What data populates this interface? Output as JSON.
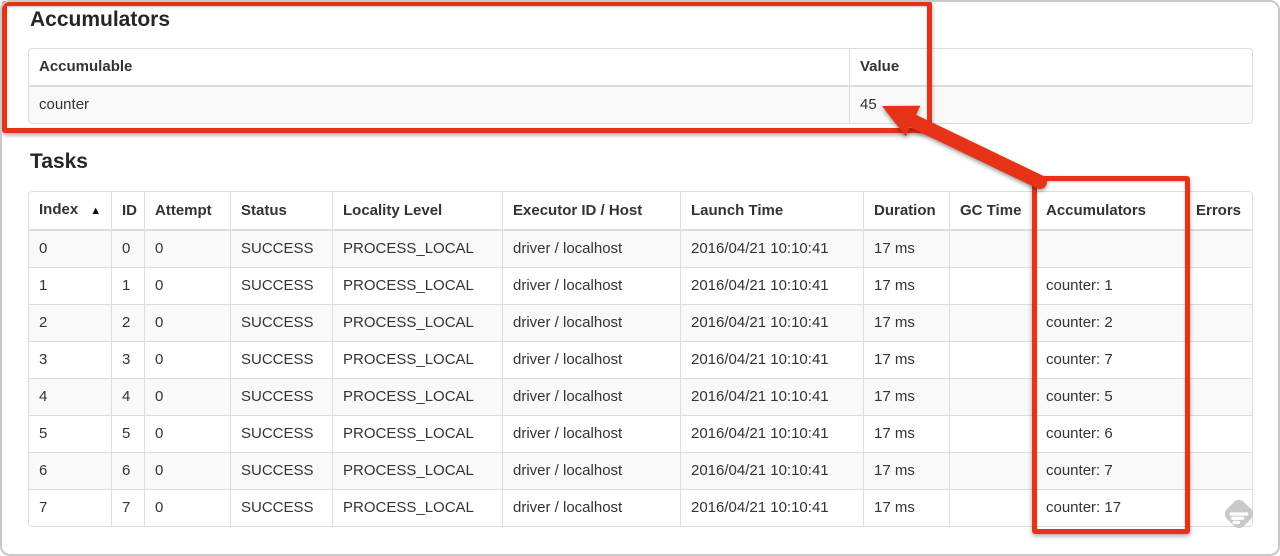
{
  "annotation": {
    "color": "#e63317",
    "highlighted_value": "45",
    "highlighted_column": "Accumulators"
  },
  "accumulators_section": {
    "title": "Accumulators",
    "table": {
      "headers": [
        "Accumulable",
        "Value"
      ],
      "column_keys": [
        "accumulable",
        "value"
      ],
      "rows": [
        [
          "counter",
          "45"
        ]
      ]
    }
  },
  "tasks_section": {
    "title": "Tasks",
    "table": {
      "headers": [
        "Index",
        "ID",
        "Attempt",
        "Status",
        "Locality Level",
        "Executor ID / Host",
        "Launch Time",
        "Duration",
        "GC Time",
        "Accumulators",
        "Errors"
      ],
      "column_keys": [
        "index",
        "id",
        "attempt",
        "status",
        "locality-level",
        "executor-id-host",
        "launch-time",
        "duration",
        "gc-time",
        "accumulators",
        "errors"
      ],
      "sort_icon": "▲",
      "sorted_column": "Index",
      "rows": [
        [
          "0",
          "0",
          "0",
          "SUCCESS",
          "PROCESS_LOCAL",
          "driver / localhost",
          "2016/04/21 10:10:41",
          "17 ms",
          "",
          "",
          ""
        ],
        [
          "1",
          "1",
          "0",
          "SUCCESS",
          "PROCESS_LOCAL",
          "driver / localhost",
          "2016/04/21 10:10:41",
          "17 ms",
          "",
          "counter: 1",
          ""
        ],
        [
          "2",
          "2",
          "0",
          "SUCCESS",
          "PROCESS_LOCAL",
          "driver / localhost",
          "2016/04/21 10:10:41",
          "17 ms",
          "",
          "counter: 2",
          ""
        ],
        [
          "3",
          "3",
          "0",
          "SUCCESS",
          "PROCESS_LOCAL",
          "driver / localhost",
          "2016/04/21 10:10:41",
          "17 ms",
          "",
          "counter: 7",
          ""
        ],
        [
          "4",
          "4",
          "0",
          "SUCCESS",
          "PROCESS_LOCAL",
          "driver / localhost",
          "2016/04/21 10:10:41",
          "17 ms",
          "",
          "counter: 5",
          ""
        ],
        [
          "5",
          "5",
          "0",
          "SUCCESS",
          "PROCESS_LOCAL",
          "driver / localhost",
          "2016/04/21 10:10:41",
          "17 ms",
          "",
          "counter: 6",
          ""
        ],
        [
          "6",
          "6",
          "0",
          "SUCCESS",
          "PROCESS_LOCAL",
          "driver / localhost",
          "2016/04/21 10:10:41",
          "17 ms",
          "",
          "counter: 7",
          ""
        ],
        [
          "7",
          "7",
          "0",
          "SUCCESS",
          "PROCESS_LOCAL",
          "driver / localhost",
          "2016/04/21 10:10:41",
          "17 ms",
          "",
          "counter: 17",
          ""
        ]
      ]
    }
  },
  "watermark": {
    "icon": "feedly-logo",
    "color": "#c7c7c7"
  }
}
